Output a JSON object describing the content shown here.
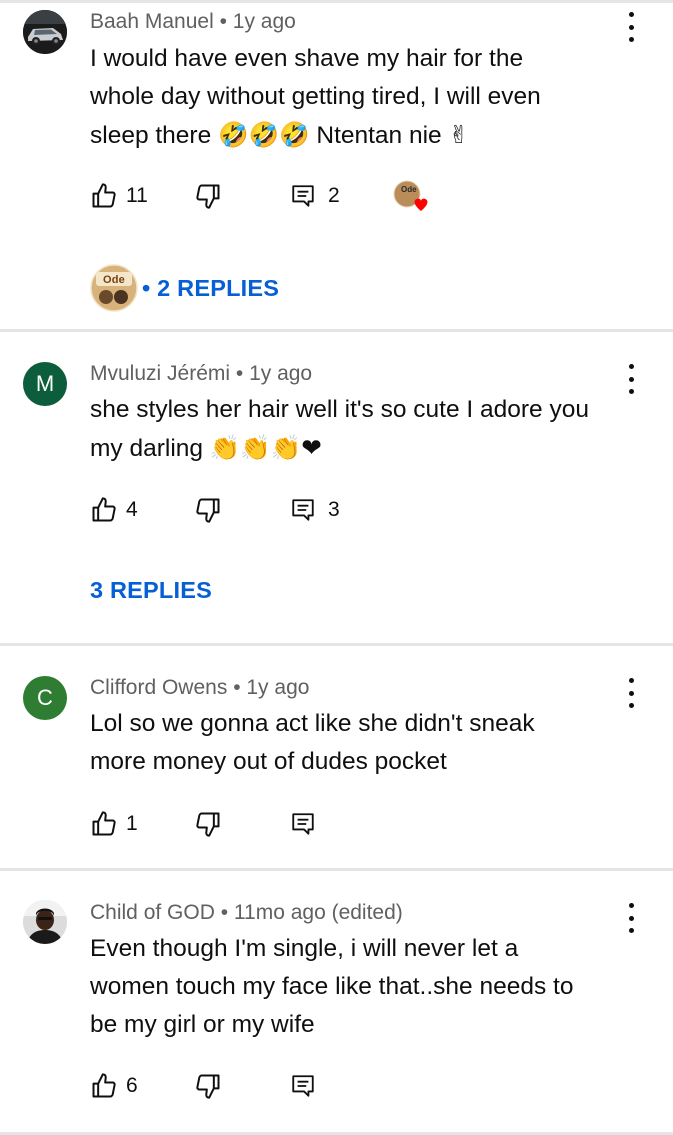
{
  "comments": [
    {
      "author": "Baah Manuel",
      "time": "1y ago",
      "edited": "",
      "line1": "I would have even shave my hair for the",
      "line2": "whole day without getting tired, I will even",
      "line3_text": "sleep there ",
      "line3_emoji": "🤣🤣🤣",
      "line3_tail": " Ntentan nie ",
      "line3_end_emoji": "✌",
      "likes": "11",
      "replies_count": "2",
      "replies_label": "• 2 REPLIES",
      "avatar_type": "photo-car",
      "creator_heart_badge": "Ode",
      "reply_avatar_badge": "Ode"
    },
    {
      "author": "Mvuluzi Jérémi",
      "time": "1y ago",
      "line1": "she styles her hair well it's so cute I adore you",
      "line2_text": "my darling ",
      "line2_emoji": "👏👏👏❤",
      "likes": "4",
      "replies_count": "3",
      "replies_label": "3 REPLIES",
      "avatar_letter": "M",
      "avatar_color": "#0b5d3b"
    },
    {
      "author": "Clifford Owens",
      "time": "1y ago",
      "line1": "Lol so we gonna act like she didn't sneak",
      "line2": "more money out of dudes pocket",
      "likes": "1",
      "avatar_letter": "C",
      "avatar_color": "#2e7d32"
    },
    {
      "author": "Child of GOD",
      "time": "11mo ago (edited)",
      "line1": "Even though I'm single, i will never let a",
      "line2": "women touch my face like that..she needs to",
      "line3": "be my girl or my wife",
      "likes": "6",
      "avatar_type": "photo-person"
    }
  ],
  "icons": {
    "like": "thumbs-up-icon",
    "dislike": "thumbs-down-icon",
    "reply": "reply-icon",
    "more": "more-vert-icon"
  },
  "colors": {
    "link_blue": "#065fd4",
    "meta_gray": "#606060",
    "divider": "#e5e5e5"
  }
}
